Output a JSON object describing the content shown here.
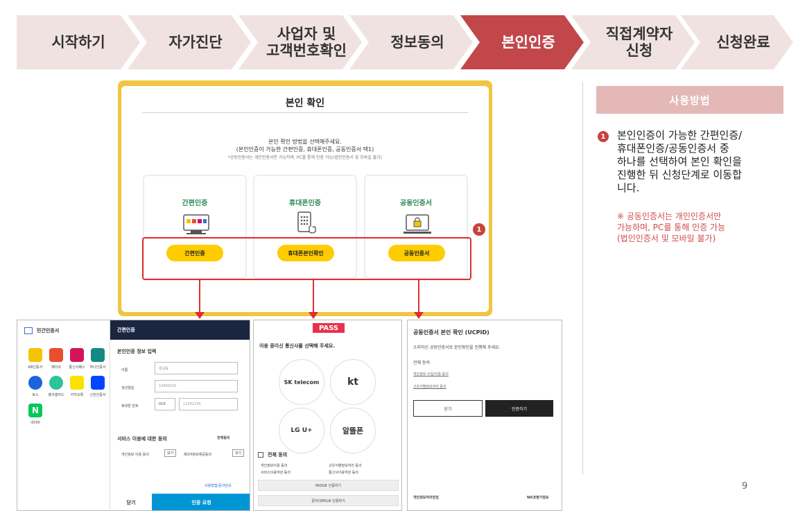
{
  "steps": [
    {
      "label": "시작하기",
      "active": false
    },
    {
      "label": "자가진단",
      "active": false
    },
    {
      "label": "사업자 및\n고객번호확인",
      "active": false
    },
    {
      "label": "정보동의",
      "active": false
    },
    {
      "label": "본인인증",
      "active": true
    },
    {
      "label": "직접계약자\n신청",
      "active": false
    },
    {
      "label": "신청완료",
      "active": false
    }
  ],
  "colors": {
    "step_bg": "#f1e2e2",
    "step_active": "#c1474a",
    "accent_yellow": "#ffcc00",
    "accent_red": "#e02d2d",
    "guide_head": "#e5b8b8"
  },
  "panel": {
    "title": "본인 확인",
    "guide_line1": "본인 확인 방법을 선택해주세요.",
    "guide_line2": "(본인인증이 가능한 간편인증, 휴대폰인증, 공동인증서 택1)",
    "guide_line3": "*공동인증서는 개인인증서만 가능하며, PC를 통해 인증 가능(법인인증서 및 모바일 불가)",
    "options": [
      {
        "title": "간편인증",
        "button": "간편인증",
        "icon": "simple-auth-icon"
      },
      {
        "title": "휴대폰인증",
        "button": "휴대폰본인확인",
        "icon": "phone-auth-icon"
      },
      {
        "title": "공동인증서",
        "button": "공동인증서",
        "icon": "certificate-icon"
      }
    ],
    "badge": "1"
  },
  "guide": {
    "heading": "사용방법",
    "badge": "1",
    "text": "본인인증이 가능한 간편인증/\n휴대폰인증/공동인증서 중\n하나를 선택하여 본인 확인을\n진행한 뒤 신청단계로 이동합\n니다.",
    "note": "※ 공동인증서는 개인인증서만\n가능하며, PC를 통해 인증 가능\n(법인인증서 및 모바일 불가)"
  },
  "page_number": "9",
  "simple_auth_popup": {
    "left_title": "민간인증서",
    "providers": [
      "KB인증서",
      "페이코",
      "통신사패스",
      "하나인증서",
      "토스",
      "뱅크샐러드",
      "카카오톡",
      "신한인증서",
      "네이버"
    ],
    "right_title": "간편인증",
    "section_title": "본인인증 정보 입력",
    "name_label": "이름",
    "name_placeholder": "홍길동",
    "birth_label": "생년월일",
    "birth_placeholder": "19900101",
    "phone_label": "휴대폰 번호",
    "phone_prefix": "010",
    "phone_placeholder": "12341234",
    "consent_title": "서비스 이용에 대한 동의",
    "consent_all": "전체동의",
    "consent_item1": "개인정보 이용 동의",
    "consent_item2": "제3자정보제공동의",
    "view_label": "보기",
    "help_link": "사용방법/문의안내",
    "close_button": "닫기",
    "request_button": "인증 요청"
  },
  "pass_popup": {
    "logo": "PASS",
    "prompt": "이용 중이신 통신사를 선택해 주세요.",
    "carriers": [
      "SK telecom",
      "kt",
      "LG U+",
      "알뜰폰"
    ],
    "all_agree": "전체 동의",
    "terms": [
      "개인정보이용 동의",
      "고유식별정보처리 동의",
      "서비스이용약관 동의",
      "통신사이용약관 동의"
    ],
    "pass_button": "PASS로 인증하기",
    "sms_button": "문자(SMS)로 인증하기"
  },
  "cert_popup": {
    "title": "공동인증서 본인 확인 (UCPID)",
    "subtitle": "소지하신 공동인증서로 본인확인을 진행해 주세요.",
    "all_agree": "전체 동의",
    "terms": [
      "개인정보 수집/이용 동의",
      "고유식별정보처리 동의"
    ],
    "close_button": "닫기",
    "confirm_button": "인증하기",
    "footer_left": "개인정보처리방침",
    "footer_right": "NICE평가정보"
  }
}
